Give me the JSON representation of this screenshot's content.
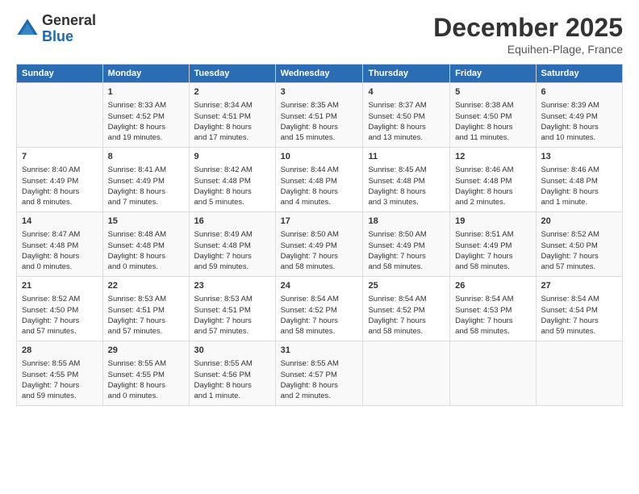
{
  "logo": {
    "general": "General",
    "blue": "Blue"
  },
  "title": "December 2025",
  "location": "Equihen-Plage, France",
  "days_of_week": [
    "Sunday",
    "Monday",
    "Tuesday",
    "Wednesday",
    "Thursday",
    "Friday",
    "Saturday"
  ],
  "weeks": [
    [
      {
        "day": "",
        "data": ""
      },
      {
        "day": "1",
        "data": "Sunrise: 8:33 AM\nSunset: 4:52 PM\nDaylight: 8 hours\nand 19 minutes."
      },
      {
        "day": "2",
        "data": "Sunrise: 8:34 AM\nSunset: 4:51 PM\nDaylight: 8 hours\nand 17 minutes."
      },
      {
        "day": "3",
        "data": "Sunrise: 8:35 AM\nSunset: 4:51 PM\nDaylight: 8 hours\nand 15 minutes."
      },
      {
        "day": "4",
        "data": "Sunrise: 8:37 AM\nSunset: 4:50 PM\nDaylight: 8 hours\nand 13 minutes."
      },
      {
        "day": "5",
        "data": "Sunrise: 8:38 AM\nSunset: 4:50 PM\nDaylight: 8 hours\nand 11 minutes."
      },
      {
        "day": "6",
        "data": "Sunrise: 8:39 AM\nSunset: 4:49 PM\nDaylight: 8 hours\nand 10 minutes."
      }
    ],
    [
      {
        "day": "7",
        "data": "Sunrise: 8:40 AM\nSunset: 4:49 PM\nDaylight: 8 hours\nand 8 minutes."
      },
      {
        "day": "8",
        "data": "Sunrise: 8:41 AM\nSunset: 4:49 PM\nDaylight: 8 hours\nand 7 minutes."
      },
      {
        "day": "9",
        "data": "Sunrise: 8:42 AM\nSunset: 4:48 PM\nDaylight: 8 hours\nand 5 minutes."
      },
      {
        "day": "10",
        "data": "Sunrise: 8:44 AM\nSunset: 4:48 PM\nDaylight: 8 hours\nand 4 minutes."
      },
      {
        "day": "11",
        "data": "Sunrise: 8:45 AM\nSunset: 4:48 PM\nDaylight: 8 hours\nand 3 minutes."
      },
      {
        "day": "12",
        "data": "Sunrise: 8:46 AM\nSunset: 4:48 PM\nDaylight: 8 hours\nand 2 minutes."
      },
      {
        "day": "13",
        "data": "Sunrise: 8:46 AM\nSunset: 4:48 PM\nDaylight: 8 hours\nand 1 minute."
      }
    ],
    [
      {
        "day": "14",
        "data": "Sunrise: 8:47 AM\nSunset: 4:48 PM\nDaylight: 8 hours\nand 0 minutes."
      },
      {
        "day": "15",
        "data": "Sunrise: 8:48 AM\nSunset: 4:48 PM\nDaylight: 8 hours\nand 0 minutes."
      },
      {
        "day": "16",
        "data": "Sunrise: 8:49 AM\nSunset: 4:48 PM\nDaylight: 7 hours\nand 59 minutes."
      },
      {
        "day": "17",
        "data": "Sunrise: 8:50 AM\nSunset: 4:49 PM\nDaylight: 7 hours\nand 58 minutes."
      },
      {
        "day": "18",
        "data": "Sunrise: 8:50 AM\nSunset: 4:49 PM\nDaylight: 7 hours\nand 58 minutes."
      },
      {
        "day": "19",
        "data": "Sunrise: 8:51 AM\nSunset: 4:49 PM\nDaylight: 7 hours\nand 58 minutes."
      },
      {
        "day": "20",
        "data": "Sunrise: 8:52 AM\nSunset: 4:50 PM\nDaylight: 7 hours\nand 57 minutes."
      }
    ],
    [
      {
        "day": "21",
        "data": "Sunrise: 8:52 AM\nSunset: 4:50 PM\nDaylight: 7 hours\nand 57 minutes."
      },
      {
        "day": "22",
        "data": "Sunrise: 8:53 AM\nSunset: 4:51 PM\nDaylight: 7 hours\nand 57 minutes."
      },
      {
        "day": "23",
        "data": "Sunrise: 8:53 AM\nSunset: 4:51 PM\nDaylight: 7 hours\nand 57 minutes."
      },
      {
        "day": "24",
        "data": "Sunrise: 8:54 AM\nSunset: 4:52 PM\nDaylight: 7 hours\nand 58 minutes."
      },
      {
        "day": "25",
        "data": "Sunrise: 8:54 AM\nSunset: 4:52 PM\nDaylight: 7 hours\nand 58 minutes."
      },
      {
        "day": "26",
        "data": "Sunrise: 8:54 AM\nSunset: 4:53 PM\nDaylight: 7 hours\nand 58 minutes."
      },
      {
        "day": "27",
        "data": "Sunrise: 8:54 AM\nSunset: 4:54 PM\nDaylight: 7 hours\nand 59 minutes."
      }
    ],
    [
      {
        "day": "28",
        "data": "Sunrise: 8:55 AM\nSunset: 4:55 PM\nDaylight: 7 hours\nand 59 minutes."
      },
      {
        "day": "29",
        "data": "Sunrise: 8:55 AM\nSunset: 4:55 PM\nDaylight: 8 hours\nand 0 minutes."
      },
      {
        "day": "30",
        "data": "Sunrise: 8:55 AM\nSunset: 4:56 PM\nDaylight: 8 hours\nand 1 minute."
      },
      {
        "day": "31",
        "data": "Sunrise: 8:55 AM\nSunset: 4:57 PM\nDaylight: 8 hours\nand 2 minutes."
      },
      {
        "day": "",
        "data": ""
      },
      {
        "day": "",
        "data": ""
      },
      {
        "day": "",
        "data": ""
      }
    ]
  ]
}
